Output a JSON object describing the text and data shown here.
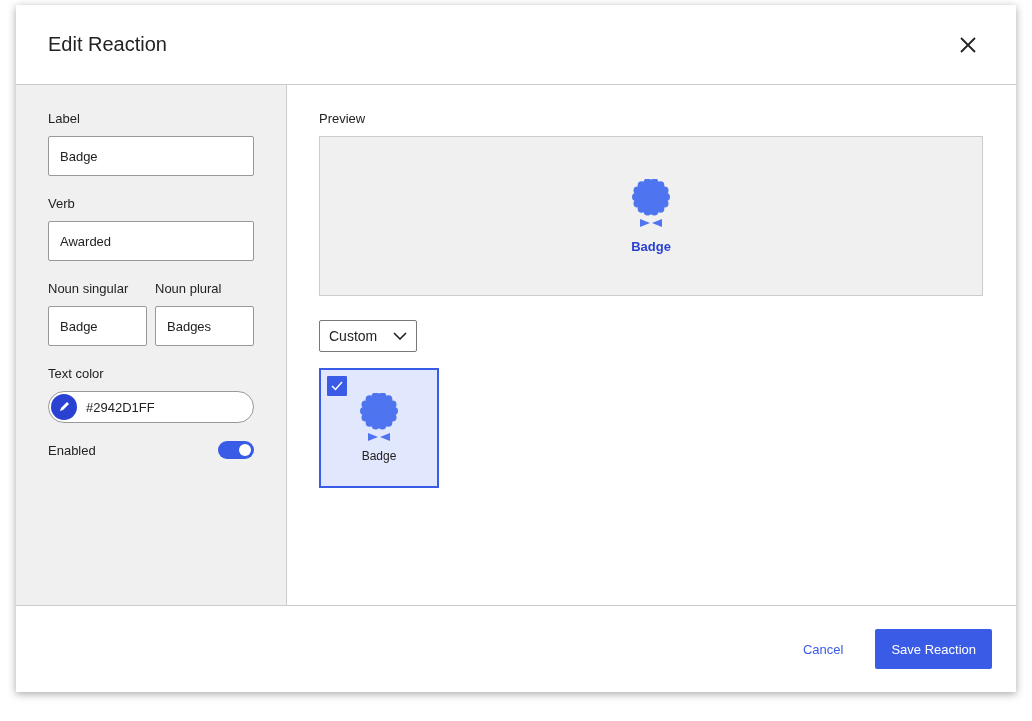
{
  "dialog": {
    "title": "Edit Reaction"
  },
  "form": {
    "label": {
      "label": "Label",
      "value": "Badge"
    },
    "verb": {
      "label": "Verb",
      "value": "Awarded"
    },
    "noun_singular": {
      "label": "Noun singular",
      "value": "Badge"
    },
    "noun_plural": {
      "label": "Noun plural",
      "value": "Badges"
    },
    "text_color": {
      "label": "Text color",
      "value": "#2942D1FF"
    },
    "enabled": {
      "label": "Enabled",
      "on": true
    }
  },
  "preview": {
    "heading": "Preview",
    "label": "Badge"
  },
  "icon_set": {
    "value": "Custom"
  },
  "reactions": [
    {
      "label": "Badge",
      "selected": true
    }
  ],
  "buttons": {
    "cancel": "Cancel",
    "save": "Save Reaction"
  }
}
